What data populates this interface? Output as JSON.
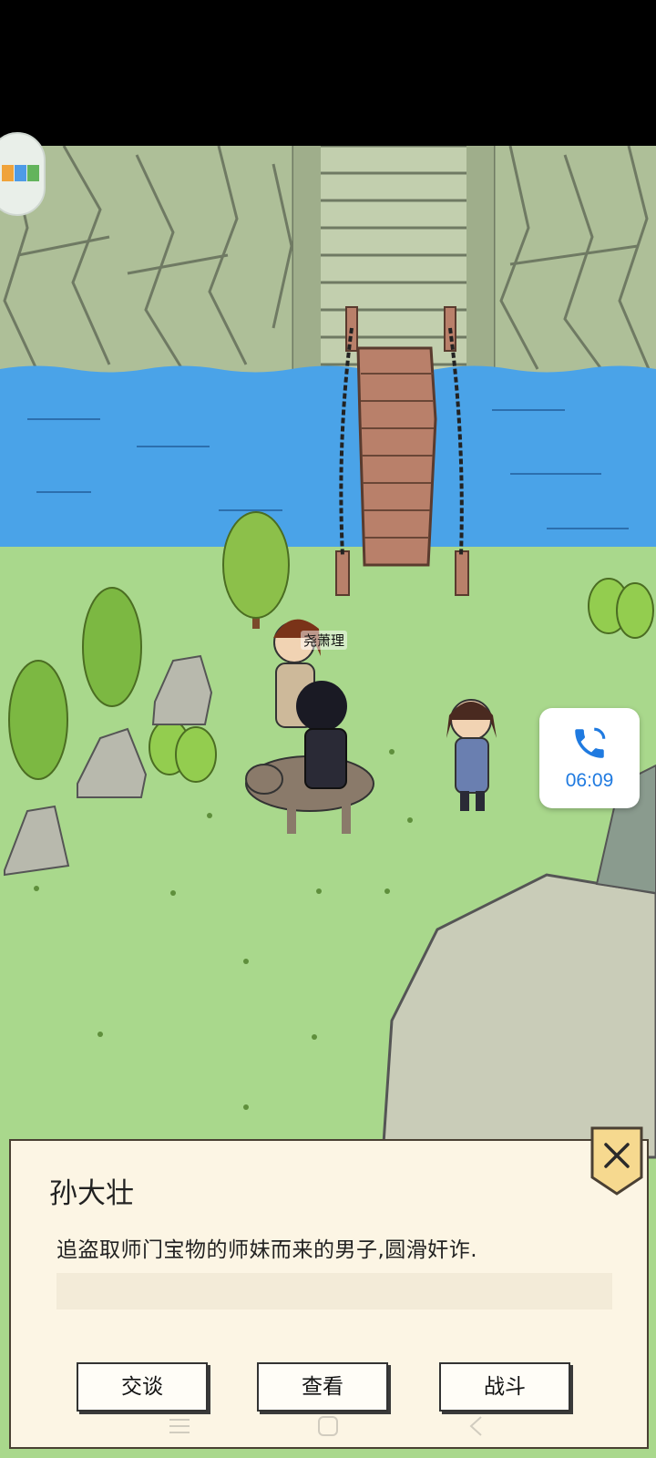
{
  "npc_tag": "尧萧理",
  "call_widget": {
    "icon": "phone-icon",
    "time": "06:09"
  },
  "dialog": {
    "name": "孙大壮",
    "description": "追盗取师门宝物的师妹而来的男子,圆滑奸诈.",
    "close_icon": "close-icon"
  },
  "actions": {
    "talk": "交谈",
    "view": "查看",
    "fight": "战斗"
  },
  "colors": {
    "grass": "#a9d88c",
    "water": "#4aa3e8",
    "cliff": "#aebf98",
    "dialog_bg": "#fcf5e4",
    "accent_blue": "#1f7ae0",
    "close_bg": "#f6d98f"
  }
}
